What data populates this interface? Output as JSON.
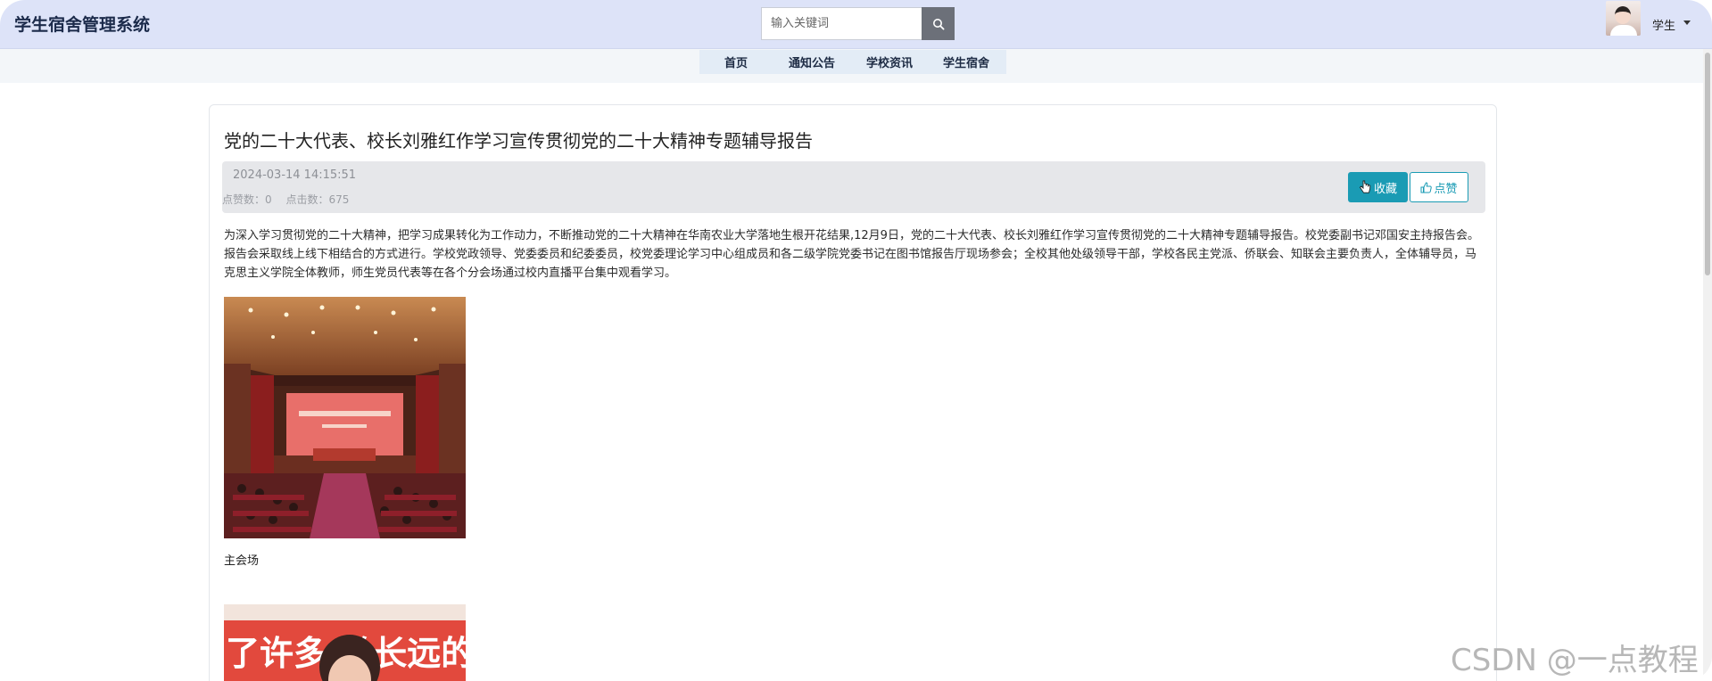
{
  "header": {
    "brand": "学生宿舍管理系统",
    "search_placeholder": "输入关键词",
    "user_name": "学生"
  },
  "nav": {
    "items": [
      "首页",
      "通知公告",
      "学校资讯",
      "学生宿舍"
    ]
  },
  "article": {
    "title": "党的二十大代表、校长刘雅红作学习宣传贯彻党的二十大精神专题辅导报告",
    "date": "2024-03-14 14:15:51",
    "likes_label": "点赞数：0",
    "clicks_label": "点击数：675",
    "fav_label": "收藏",
    "like_label": "点赞",
    "body": "为深入学习贯彻党的二十大精神，把学习成果转化为工作动力，不断推动党的二十大精神在华南农业大学落地生根开花结果,12月9日，党的二十大代表、校长刘雅红作学习宣传贯彻党的二十大精神专题辅导报告。校党委副书记邓国安主持报告会。报告会采取线上线下相结合的方式进行。学校党政领导、党委委员和纪委委员，校党委理论学习中心组成员和各二级学院党委书记在图书馆报告厅现场参会；全校其他处级领导干部，学校各民主党派、侨联会、知联会主要负责人，全体辅导员，马克思主义学院全体教师，师生党员代表等在各个分会场通过校内直播平台集中观看学习。",
    "photo1_caption": "主会场",
    "photo2_text": "了许多  关长远的"
  },
  "watermark": "CSDN @一点教程",
  "colors": {
    "header_bg": "#dde3f8",
    "accent": "#1a9bb4",
    "meta_bg": "#e6e7ea"
  }
}
